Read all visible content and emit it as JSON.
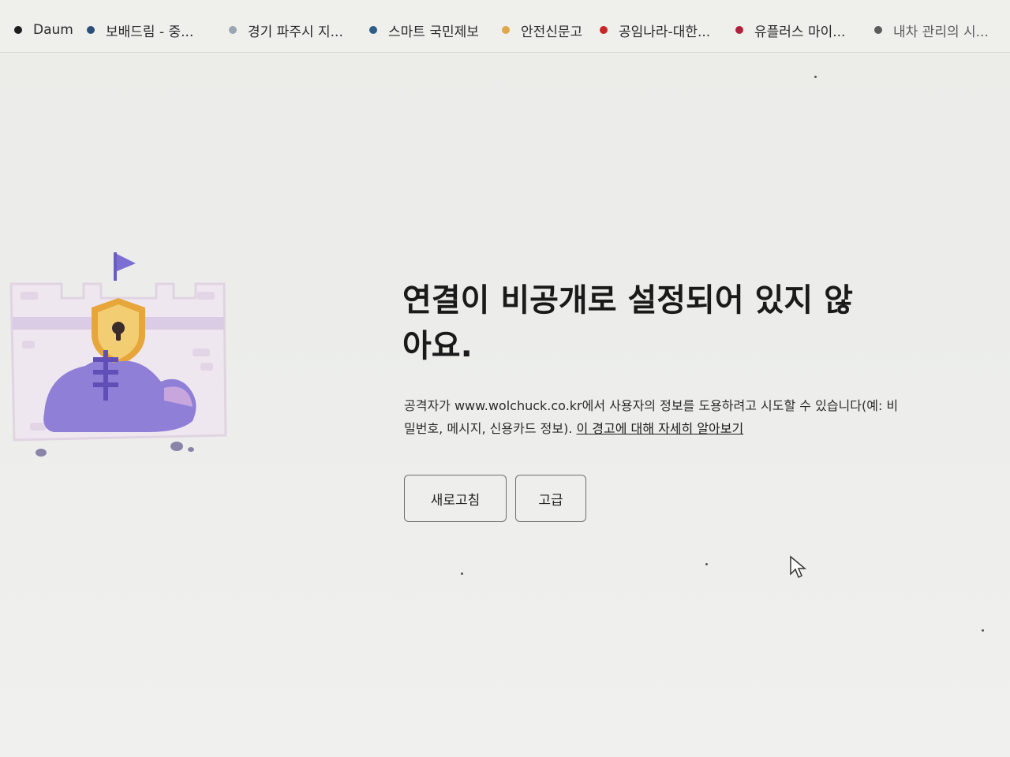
{
  "bookmarks": [
    {
      "label": "Daum",
      "color": "#1e1e1e"
    },
    {
      "label": "보배드림 - 중...",
      "color": "#2c4f78"
    },
    {
      "label": "경기 파주시 지...",
      "color": "#9aa6b2"
    },
    {
      "label": "스마트 국민제보",
      "color": "#2b5e86"
    },
    {
      "label": "안전신문고",
      "color": "#e0a64a"
    },
    {
      "label": "공임나라-대한...",
      "color": "#c62828"
    },
    {
      "label": "유플러스 마이...",
      "color": "#b0213a"
    },
    {
      "label": "내차 관리의 시...",
      "color": "#2a2a2a"
    }
  ],
  "error": {
    "title": "연결이 비공개로 설정되어 있지 않아요.",
    "description": "공격자가 www.wolchuck.co.kr에서 사용자의 정보를 도용하려고 시도할 수 있습니다(예: 비밀번호, 메시지, 신용카드 정보).",
    "learn_more": "이 경고에 대해 자세히 알아보기"
  },
  "buttons": {
    "reload": "새로고침",
    "advanced": "고급"
  },
  "illustration": {
    "icon": "castle-shield-lock-icon",
    "accent": "#8f7fd6"
  }
}
